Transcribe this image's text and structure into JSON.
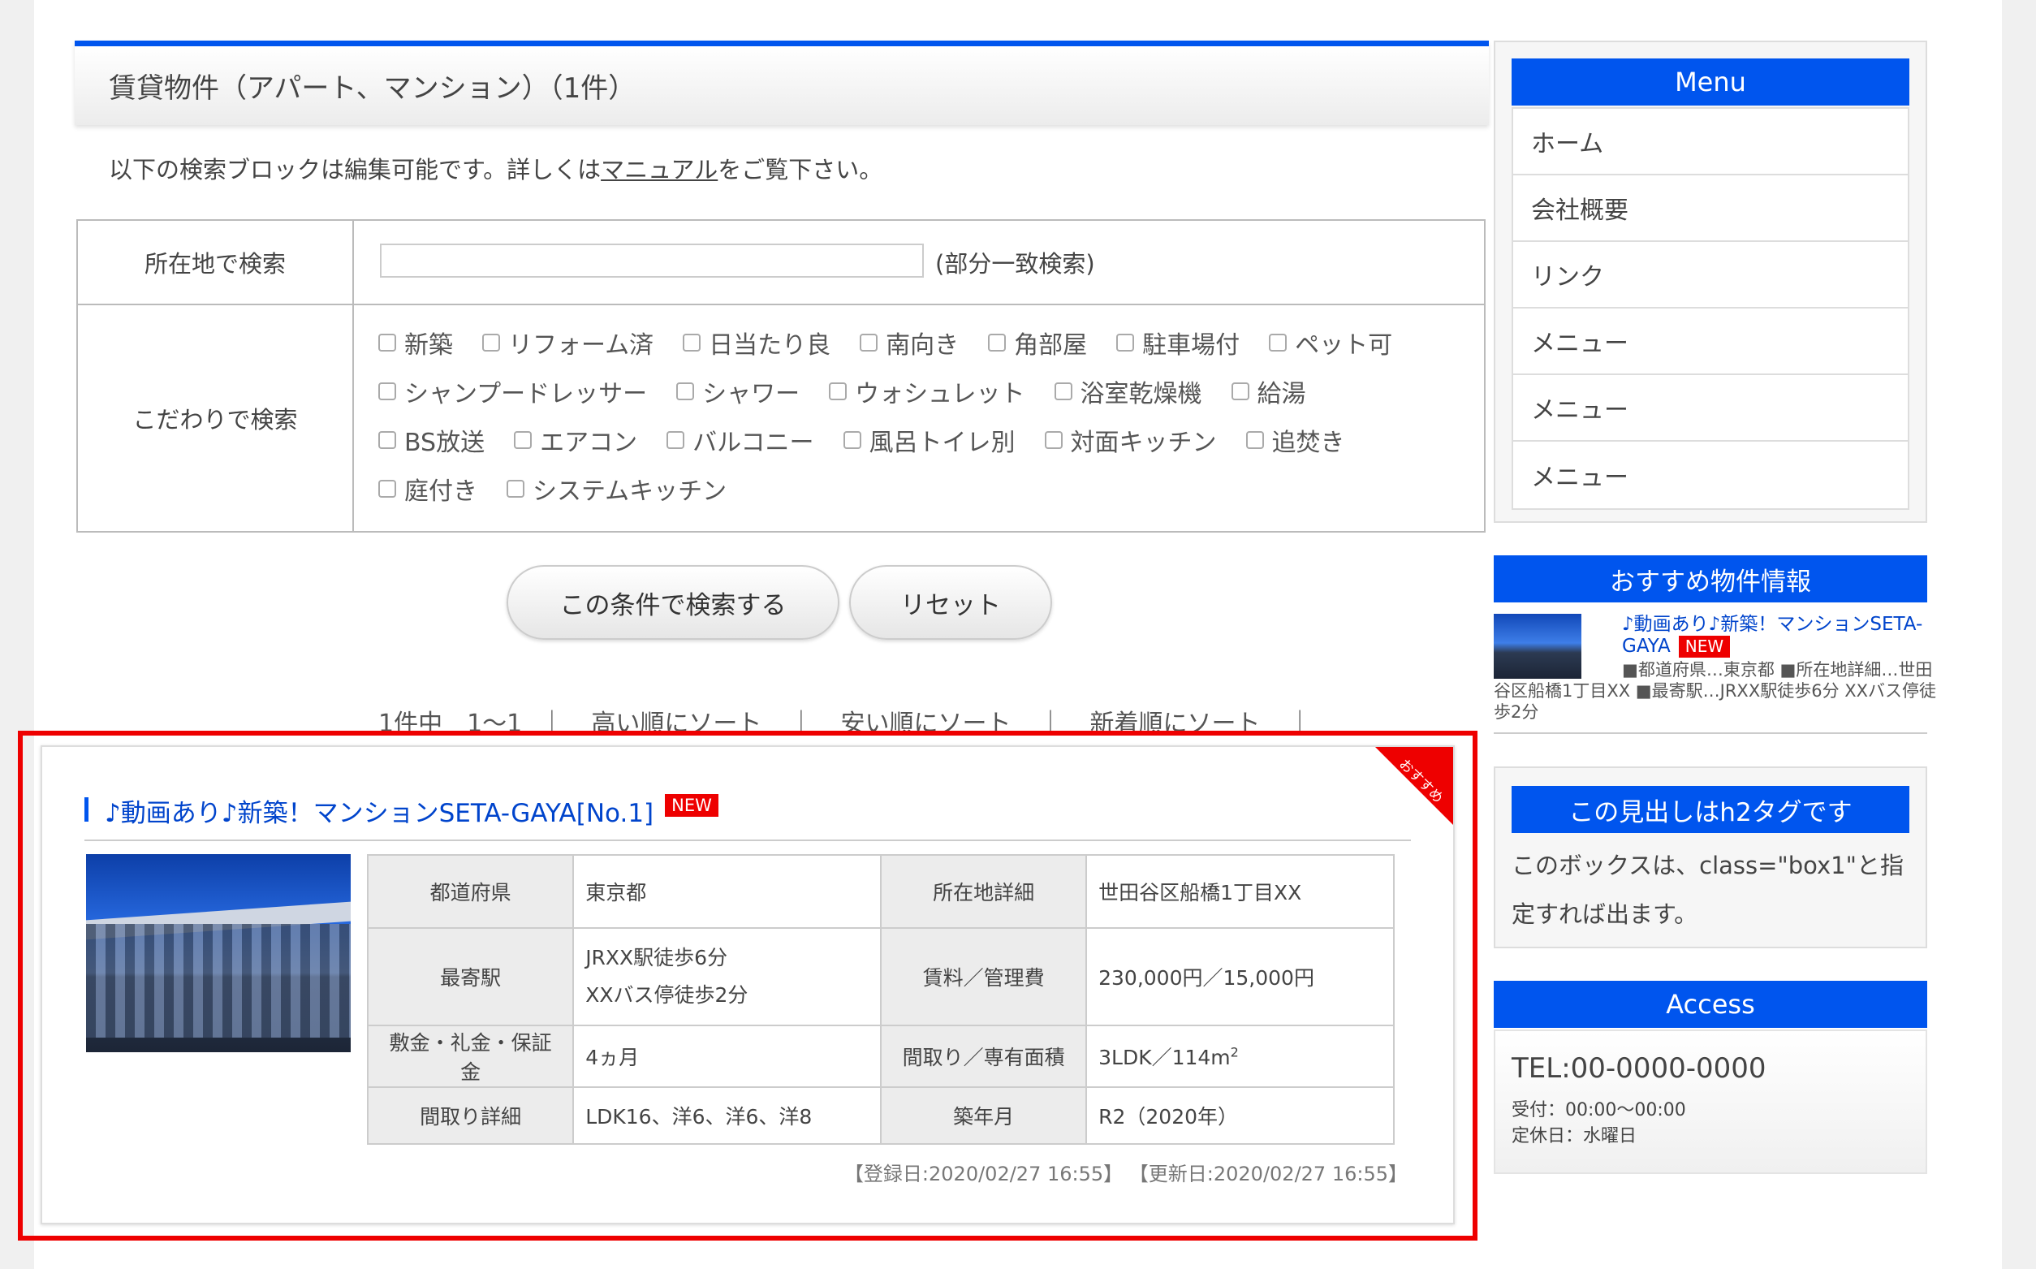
{
  "main": {
    "title": "賃貸物件（アパート、マンション）（1件）",
    "intro_before": "以下の検索ブロックは編集可能です。詳しくは",
    "intro_link": "マニュアル",
    "intro_after": "をご覧下さい。",
    "search": {
      "location_label": "所在地で検索",
      "location_value": "",
      "location_note": "(部分一致検索)",
      "features_label": "こだわりで検索",
      "features": [
        [
          "新築",
          "リフォーム済",
          "日当たり良",
          "南向き",
          "角部屋",
          "駐車場付",
          "ペット可"
        ],
        [
          "シャンプードレッサー",
          "シャワー",
          "ウォシュレット",
          "浴室乾燥機",
          "給湯"
        ],
        [
          "BS放送",
          "エアコン",
          "バルコニー",
          "風呂トイレ別",
          "対面キッチン",
          "追焚き"
        ],
        [
          "庭付き",
          "システムキッチン"
        ]
      ],
      "search_button": "この条件で検索する",
      "reset_button": "リセット"
    },
    "sortbar": {
      "count": "1件中　1〜1",
      "sort_high": "高い順にソート",
      "sort_low": "安い順にソート",
      "sort_new": "新着順にソート",
      "sep": "｜"
    },
    "listing": {
      "ribbon": "おすすめ",
      "title": "♪動画あり♪新築！マンションSETA-GAYA[No.1]",
      "badge": "NEW",
      "rows": [
        {
          "k1": "都道府県",
          "v1": "東京都",
          "k2": "所在地詳細",
          "v2": "世田谷区船橋1丁目XX"
        },
        {
          "k1": "最寄駅",
          "v1a": "JRXX駅徒歩6分",
          "v1b": "XXバス停徒歩2分",
          "k2": "賃料／管理費",
          "v2": "230,000円／15,000円"
        },
        {
          "k1": "敷金・礼金・保証金",
          "v1": "4ヵ月",
          "k2": "間取り／専有面積",
          "v2": "3LDK／114m",
          "v2_sup": "2"
        },
        {
          "k1": "間取り詳細",
          "v1": "LDK16、洋6、洋6、洋8",
          "k2": "築年月",
          "v2": "R2（2020年）"
        }
      ],
      "registered": "【登録日:2020/02/27 16:55】",
      "updated": "【更新日:2020/02/27 16:55】"
    }
  },
  "sidebar": {
    "menu_title": "Menu",
    "menu_items": [
      "ホーム",
      "会社概要",
      "リンク",
      "メニュー",
      "メニュー",
      "メニュー"
    ],
    "recommended_title": "おすすめ物件情報",
    "recommended_item_title": "♪動画あり♪新築！マンションSETA-GAYA",
    "recommended_badge": "NEW",
    "recommended_desc": "■都道府県…東京都 ■所在地詳細…世田谷区船橋1丁目XX ■最寄駅…JRXX駅徒歩6分 XXバス停徒歩2分",
    "h2_box_title": "この見出しはh2タグです",
    "h2_box_text": "このボックスは、class=\"box1\"と指定すれば出ます。",
    "access_title": "Access",
    "tel": "TEL:00-0000-0000",
    "hours": "受付：00:00〜00:00",
    "closed": "定休日：水曜日"
  },
  "colors": {
    "accent": "#0055ee",
    "badge": "#ee0000",
    "highlight": "#ee0000"
  }
}
